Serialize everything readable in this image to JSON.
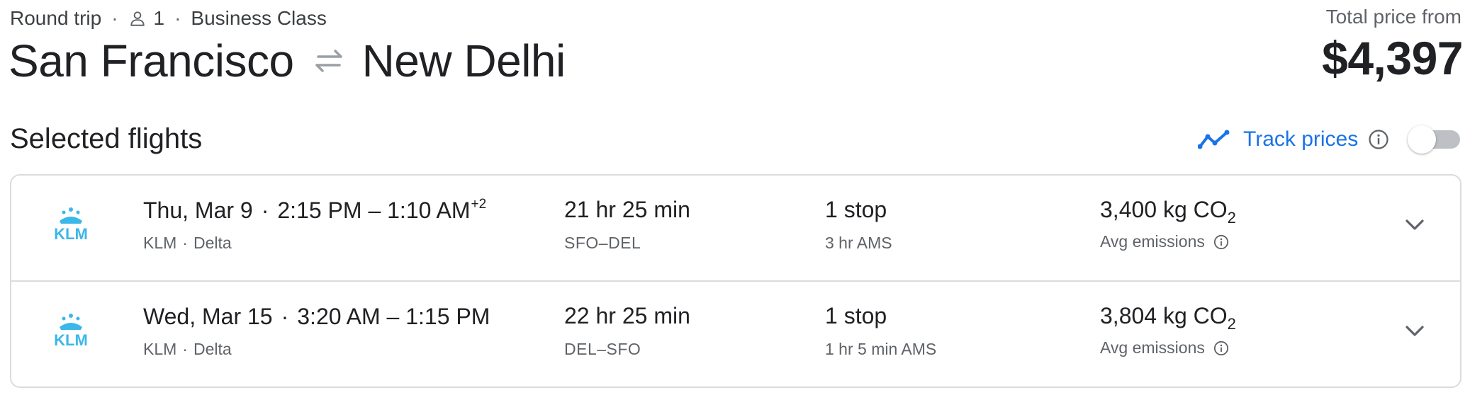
{
  "header": {
    "trip_type": "Round trip",
    "passengers": "1",
    "cabin_class": "Business Class",
    "origin": "San Francisco",
    "destination": "New Delhi",
    "price_label": "Total price from",
    "price": "$4,397"
  },
  "section": {
    "title": "Selected flights",
    "track_label": "Track prices",
    "track_enabled": false
  },
  "flights": [
    {
      "date": "Thu, Mar 9",
      "depart": "2:15 PM",
      "arrive": "1:10 AM",
      "day_offset": "+2",
      "airline": "KLM",
      "partner": "Delta",
      "duration": "21 hr 25 min",
      "route": "SFO–DEL",
      "stops": "1 stop",
      "layover": "3 hr AMS",
      "emissions": "3,400 kg CO",
      "emissions_sub": "2",
      "emissions_label": "Avg emissions"
    },
    {
      "date": "Wed, Mar 15",
      "depart": "3:20 AM",
      "arrive": "1:15 PM",
      "day_offset": "",
      "airline": "KLM",
      "partner": "Delta",
      "duration": "22 hr 25 min",
      "route": "DEL–SFO",
      "stops": "1 stop",
      "layover": "1 hr 5 min AMS",
      "emissions": "3,804 kg CO",
      "emissions_sub": "2",
      "emissions_label": "Avg emissions"
    }
  ],
  "colors": {
    "accent": "#1a73e8",
    "klm_blue": "#3bb7ea",
    "text_primary": "#202124",
    "text_secondary": "#5f6368",
    "border": "#dadce0"
  },
  "icons": {
    "person": "person-icon",
    "swap": "swap-arrows-icon",
    "trend": "trend-line-icon",
    "info": "info-icon",
    "expand": "chevron-down-icon",
    "airline_logo": "klm-logo"
  }
}
